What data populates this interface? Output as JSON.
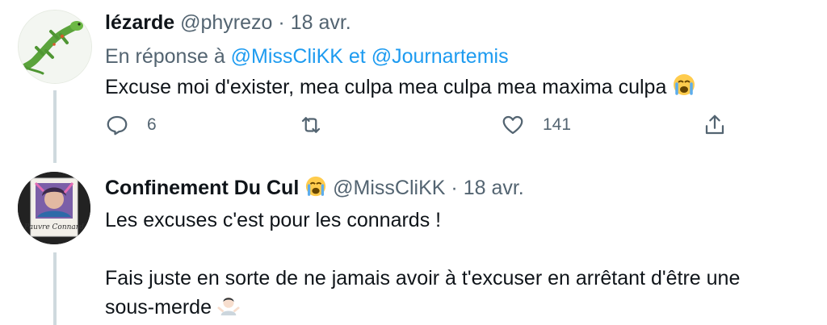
{
  "tweet1": {
    "display_name": "lézarde",
    "handle": "@phyrezo",
    "separator": "·",
    "date": "18 avr.",
    "reply_prefix": "En réponse à",
    "reply_mention1": "@MissCliKK",
    "reply_and": "et",
    "reply_mention2": "@Journartemis",
    "text": "Excuse moi d'exister, mea culpa mea culpa mea maxima culpa",
    "emoji": "crying-face",
    "actions": {
      "reply_count": "6",
      "retweet_count": "",
      "like_count": "141"
    }
  },
  "tweet2": {
    "display_name": "Confinement Du Cul",
    "name_emoji": "crying-face",
    "handle": "@MissCliKK",
    "separator": "·",
    "date": "18 avr.",
    "text_line1": "Les excuses c'est pour les connards !",
    "text_line2": "Fais juste en sorte de ne jamais avoir à t'excuser en arrêtant d'être une",
    "text_line3": "sous-merde",
    "emoji": "person-shrugging",
    "avatar_caption": "Pauvre Connard"
  },
  "colors": {
    "link": "#1d9bf0",
    "secondary_text": "#536471",
    "primary_text": "#0f1419",
    "thread_line": "#cfd9de"
  }
}
